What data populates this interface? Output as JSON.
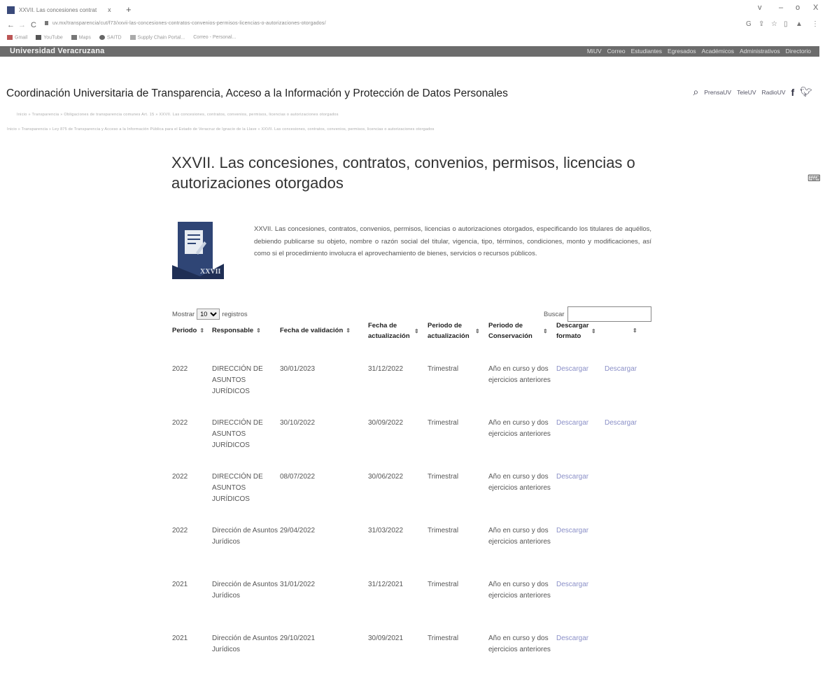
{
  "browser": {
    "tab_title": "XXVII. Las concesiones contrat",
    "tab_close": "x",
    "new_tab": "+",
    "url": "uv.mx/transparencia/cut/f73/xxvii-las-concesiones-contratos-convenios-permisos-licencias-o-autorizaciones-otorgados/",
    "bookmarks": [
      "Gmail",
      "YouTube",
      "Maps",
      "SAITD",
      "Supply Chain Portal...",
      "Correo - Personal..."
    ],
    "window_controls": [
      "v",
      "–",
      "o",
      "X"
    ]
  },
  "uv_bar": {
    "brand": "Universidad Veracruzana",
    "nav": [
      "MiUV",
      "Correo",
      "Estudiantes",
      "Egresados",
      "Académicos",
      "Administrativos",
      "Directorio"
    ]
  },
  "header": {
    "title": "Coordinación Universitaria de Transparencia, Acceso a la Información y Protección de Datos Personales",
    "links": [
      "PrensaUV",
      "TeleUV",
      "RadioUV"
    ]
  },
  "breadcrumb": {
    "line1": "Inicio  »  Transparencia  »  Obligaciones de transparencia comunes Art. 15  »  XXVII. Las concesiones, contratos, convenios, permisos, licencias o autorizaciones otorgados",
    "line2": "Inicio  »  Transparencia  »  Ley 875 de Transparencia y Acceso a la Información Pública para el Estado de Veracruz de Ignacio de la Llave  »  XXVII. Las concesiones, contratos, convenios, permisos, licencias o autorizaciones otorgados"
  },
  "page": {
    "heading": "XXVII. Las concesiones, contratos, convenios, permisos, licencias o autorizaciones otorgados",
    "icon_label": "XXVII",
    "intro": "XXVII. Las concesiones, contratos, convenios, permisos, licencias o autorizaciones otorgados, especificando los titulares de aquéllos, debiendo publicarse su objeto, nombre o razón social del titular, vigencia, tipo, términos, condiciones, monto y modificaciones, así como si el procedimiento involucra el aprovechamiento de bienes, servicios o recursos públicos."
  },
  "controls": {
    "show_prefix": "Mostrar",
    "show_value": "10",
    "show_suffix": "registros",
    "search_label": "Buscar",
    "search_value": ""
  },
  "table": {
    "headers": [
      "Periodo",
      "Responsable",
      "Fecha de validación",
      "Fecha de actualización",
      "Periodo de actualización",
      "Periodo de Conservación",
      "Descargar formato",
      ""
    ],
    "sort_glyph": "⇕",
    "rows": [
      {
        "periodo": "2022",
        "responsable": "DIRECCIÓN DE ASUNTOS JURÍDICOS",
        "validacion": "30/01/2023",
        "actualizacion": "31/12/2022",
        "periodo_act": "Trimestral",
        "conservacion": "Año en curso y dos ejercicios anteriores",
        "descargar1": "Descargar",
        "descargar2": "Descargar"
      },
      {
        "periodo": "2022",
        "responsable": "DIRECCIÓN DE ASUNTOS JURÍDICOS",
        "validacion": "30/10/2022",
        "actualizacion": "30/09/2022",
        "periodo_act": "Trimestral",
        "conservacion": "Año en curso y dos ejercicios anteriores",
        "descargar1": "Descargar",
        "descargar2": "Descargar"
      },
      {
        "periodo": "2022",
        "responsable": "DIRECCIÓN DE ASUNTOS JURÍDICOS",
        "validacion": "08/07/2022",
        "actualizacion": "30/06/2022",
        "periodo_act": "Trimestral",
        "conservacion": "Año en curso y dos ejercicios anteriores",
        "descargar1": "Descargar",
        "descargar2": ""
      },
      {
        "periodo": "2022",
        "responsable": "Dirección de Asuntos Jurídicos",
        "validacion": "29/04/2022",
        "actualizacion": "31/03/2022",
        "periodo_act": "Trimestral",
        "conservacion": "Año en curso y dos ejercicios anteriores",
        "descargar1": "Descargar",
        "descargar2": ""
      },
      {
        "periodo": "2021",
        "responsable": "Dirección de Asuntos Jurídicos",
        "validacion": "31/01/2022",
        "actualizacion": "31/12/2021",
        "periodo_act": "Trimestral",
        "conservacion": "Año en curso y dos ejercicios anteriores",
        "descargar1": "Descargar",
        "descargar2": ""
      },
      {
        "periodo": "2021",
        "responsable": "Dirección de Asuntos Jurídicos",
        "validacion": "29/10/2021",
        "actualizacion": "30/09/2021",
        "periodo_act": "Trimestral",
        "conservacion": "Año en curso y dos ejercicios anteriores",
        "descargar1": "Descargar",
        "descargar2": ""
      }
    ]
  },
  "colors": {
    "uv_bar": "#6c6c6c",
    "link": "#8a8fc7",
    "icon_bg": "#2f4575"
  }
}
